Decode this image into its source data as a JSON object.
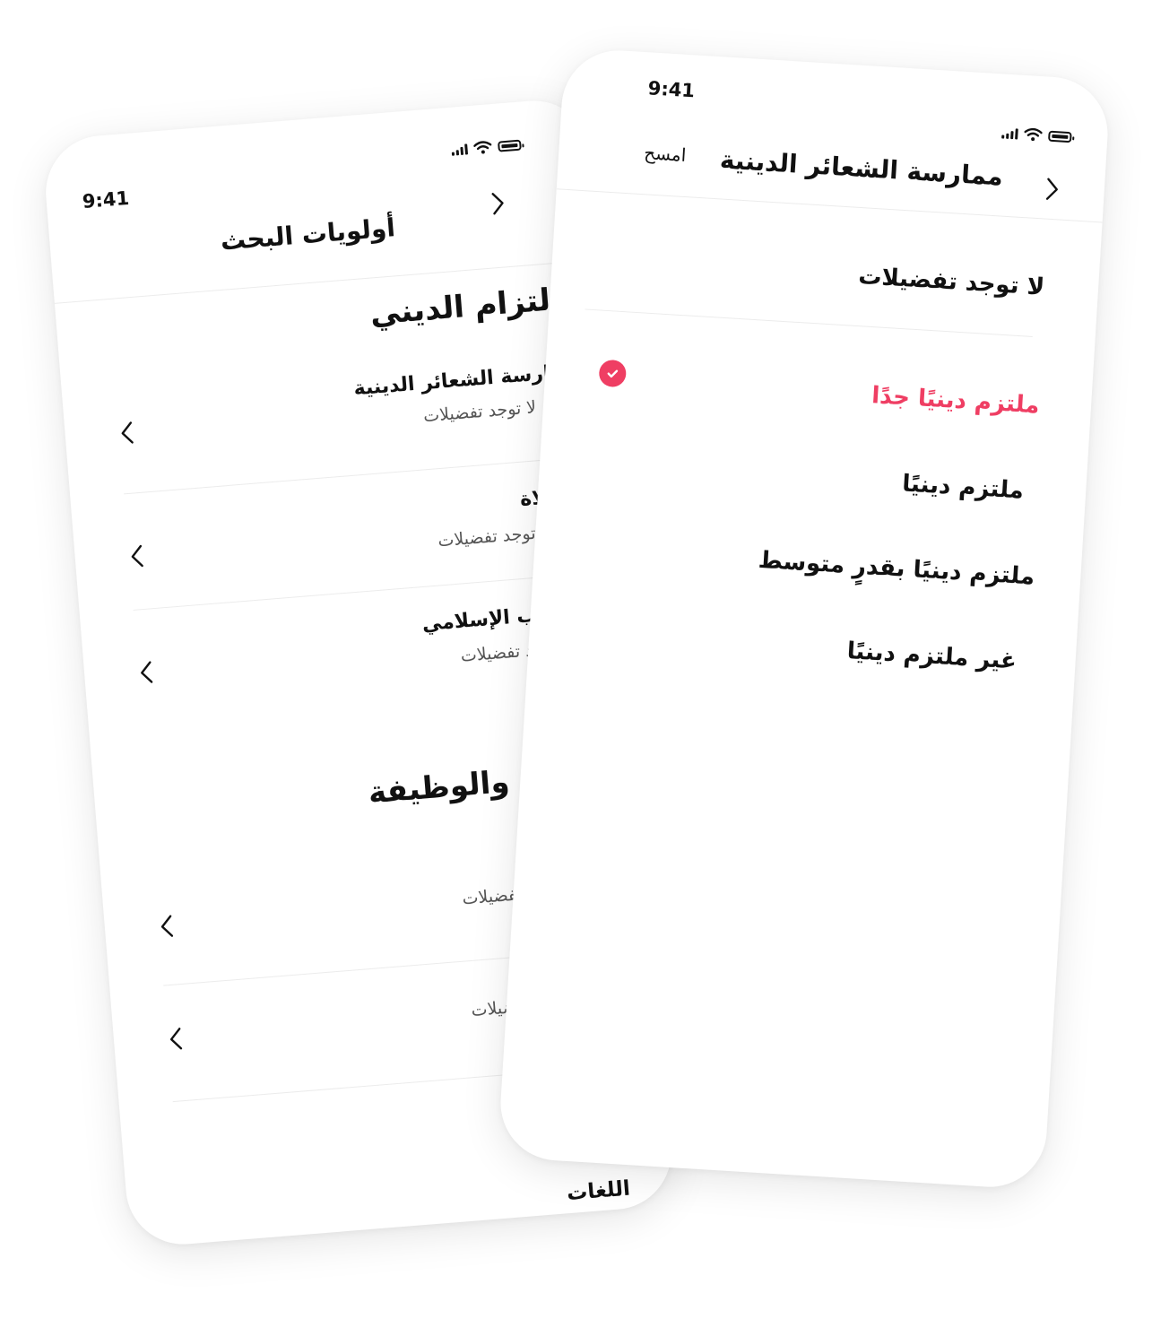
{
  "back_screen": {
    "status_time": "9:41",
    "header_title": "أولويات البحث",
    "section1_title": "الالتزام الديني",
    "rows": [
      {
        "title": "ممارسة الشعائر الدينية",
        "subtitle": "لا توجد تفضيلات"
      },
      {
        "title": "الصلاة",
        "subtitle": "لا توجد تفضيلات"
      },
      {
        "title": "المذهب الإسلامي",
        "subtitle": "لا توجد تفضيلات"
      }
    ],
    "section2_title": "التعليم والوظيفة",
    "rows2": [
      {
        "subtitle": "لا توجد تفضيلات"
      },
      {
        "subtitle": "لا توجد تفضيلات"
      }
    ],
    "section3_title": "اللغات"
  },
  "front_screen": {
    "status_time": "9:41",
    "header_title": "ممارسة الشعائر الدينية",
    "clear_label": "امسح",
    "no_preference": "لا توجد تفضيلات",
    "options": [
      {
        "label": "ملتزم دينيًا جدًا",
        "selected": true
      },
      {
        "label": "ملتزم دينيًا",
        "selected": false
      },
      {
        "label": "ملتزم دينيًا بقدرٍ متوسط",
        "selected": false
      },
      {
        "label": "غير ملتزم دينيًا",
        "selected": false
      }
    ],
    "accent_color": "#ef3e63"
  }
}
